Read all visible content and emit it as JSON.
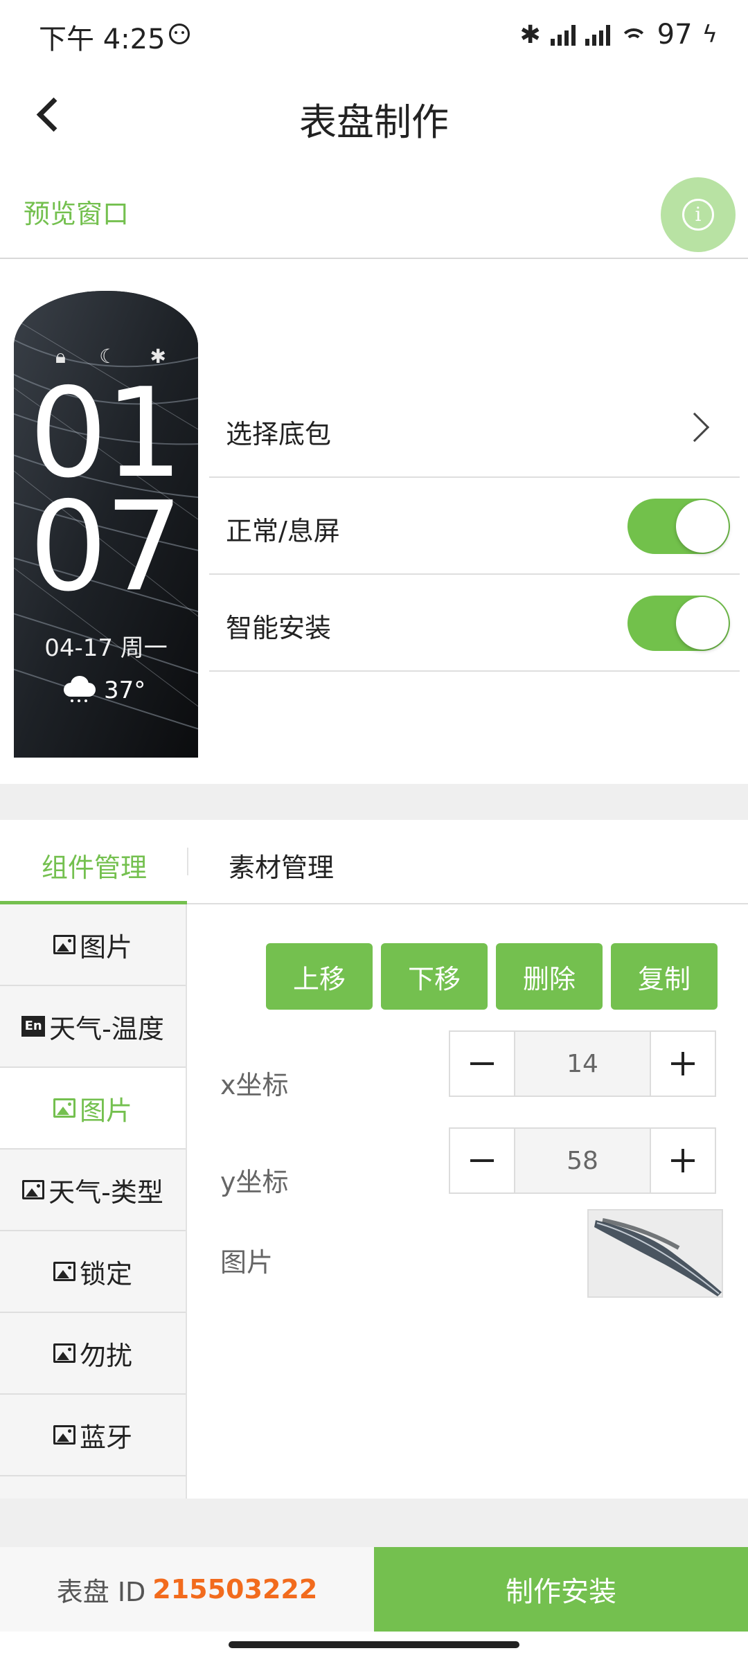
{
  "status_bar": {
    "time": "下午 4:25",
    "bluetooth_icon": "bluetooth-icon",
    "battery": "97"
  },
  "header": {
    "title": "表盘制作",
    "back_icon": "back-arrow-icon"
  },
  "preview": {
    "label": "预览窗口",
    "info_icon": "i",
    "watch": {
      "hour": "01",
      "minute": "07",
      "date": "04-17 周一",
      "temperature": "37°",
      "status_icons": [
        "lock-icon",
        "moon-icon",
        "bluetooth-icon"
      ]
    }
  },
  "settings": {
    "choose_package": "选择底包",
    "normal_off_screen": "正常/息屏",
    "normal_off_screen_on": true,
    "smart_install": "智能安装",
    "smart_install_on": true
  },
  "tabs": {
    "components": "组件管理",
    "materials": "素材管理"
  },
  "components": [
    {
      "label": "图片",
      "icon": "image-icon",
      "active": false
    },
    {
      "label": "天气-温度",
      "icon": "en-icon",
      "active": false
    },
    {
      "label": "图片",
      "icon": "image-icon",
      "active": true
    },
    {
      "label": "天气-类型",
      "icon": "image-icon",
      "active": false
    },
    {
      "label": "锁定",
      "icon": "image-icon",
      "active": false
    },
    {
      "label": "勿扰",
      "icon": "image-icon",
      "active": false
    },
    {
      "label": "蓝牙",
      "icon": "image-icon",
      "active": false
    }
  ],
  "editor": {
    "move_up": "上移",
    "move_down": "下移",
    "delete": "删除",
    "copy": "复制",
    "x_label": "x坐标",
    "x_value": "14",
    "y_label": "y坐标",
    "y_value": "58",
    "image_label": "图片"
  },
  "footer": {
    "id_label": "表盘 ID",
    "id_value": "215503222",
    "install_button": "制作安装"
  },
  "colors": {
    "accent_green": "#74c04f",
    "id_orange": "#f26b1d"
  }
}
